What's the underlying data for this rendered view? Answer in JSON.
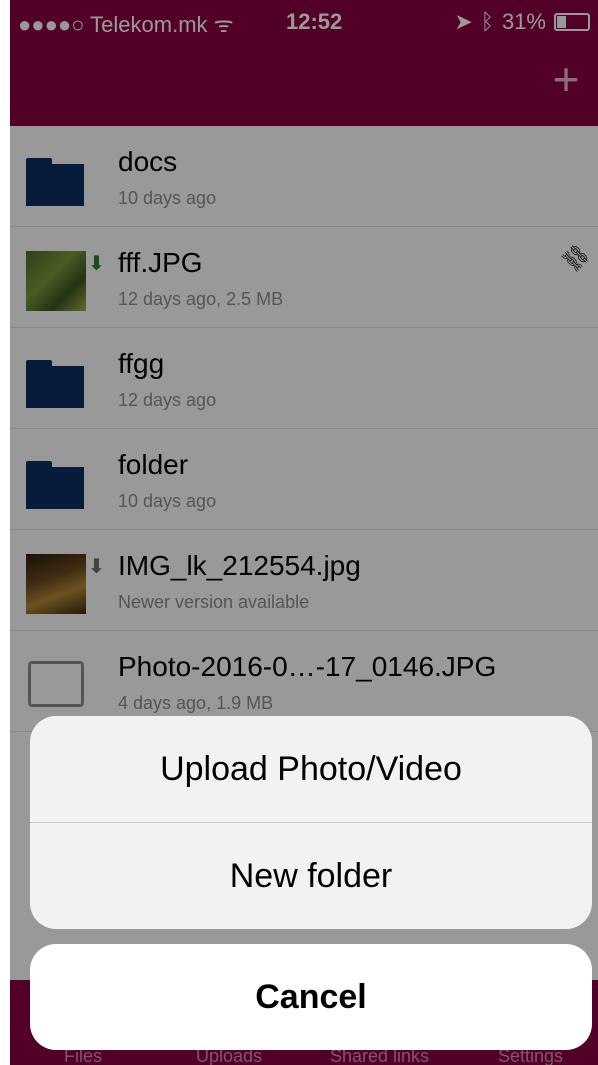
{
  "status": {
    "carrier": "●●●●○ Telekom.mk ",
    "time": "12:52",
    "battery": "31%"
  },
  "list": {
    "rows": [
      {
        "name": "docs",
        "meta": "10 days ago"
      },
      {
        "name": "fff.JPG",
        "meta": "12 days ago, 2.5 MB"
      },
      {
        "name": "ffgg",
        "meta": "12 days ago"
      },
      {
        "name": "folder",
        "meta": "10 days ago"
      },
      {
        "name": "IMG_lk_212554.jpg",
        "meta": "Newer version available"
      },
      {
        "name": "Photo-2016-0…-17_0146.JPG",
        "meta": "4 days ago, 1.9 MB"
      }
    ]
  },
  "actions": {
    "upload": "Upload Photo/Video",
    "new_folder": "New folder",
    "cancel": "Cancel"
  },
  "tabbar": {
    "files": "Files",
    "uploads": "Uploads",
    "shared": "Shared links",
    "settings": "Settings"
  }
}
